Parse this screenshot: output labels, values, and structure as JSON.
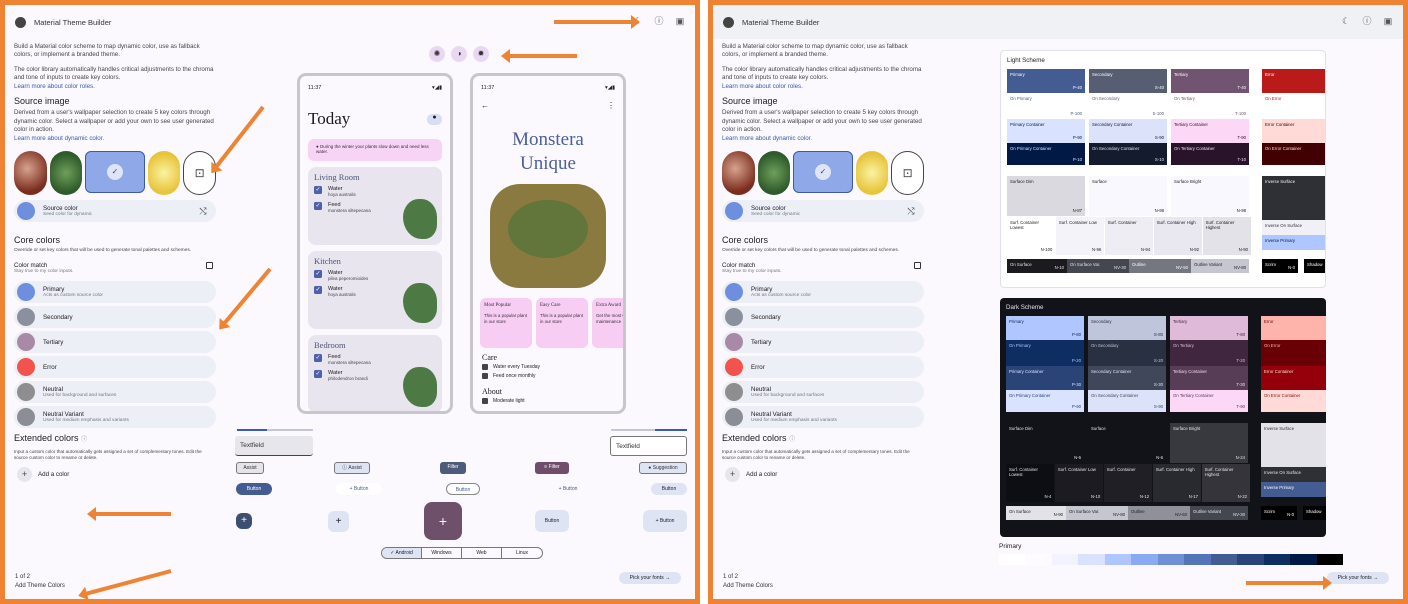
{
  "app_title": "Material Theme Builder",
  "intro": "Build a Material color scheme to map dynamic color, use as fallback colors, or implement a branded theme.",
  "intro2": "The color library automatically handles critical adjustments to the chroma and tone of inputs to create key colors.",
  "learn_colors": "Learn more about color roles.",
  "source_image_title": "Source image",
  "source_image_desc": "Derived from a user's wallpaper selection to create 5 key colors through dynamic color. Select a wallpaper or add your own to see user generated color in action.",
  "learn_dynamic": "Learn more about dynamic color.",
  "source_color": {
    "title": "Source color",
    "sub": "Seed color for dynamic"
  },
  "core_title": "Core colors",
  "core_desc": "Override or set key colors that will be used to generate tonal palettes and schemes.",
  "color_match": {
    "title": "Color match",
    "sub": "Stay true to my color inputs."
  },
  "core_colors": [
    {
      "name": "Primary",
      "sub": "Acts as custom source color",
      "color": "#6e8fde"
    },
    {
      "name": "Secondary",
      "sub": "",
      "color": "#8b909e"
    },
    {
      "name": "Tertiary",
      "sub": "",
      "color": "#a98aa6"
    },
    {
      "name": "Error",
      "sub": "",
      "color": "#f2534c"
    },
    {
      "name": "Neutral",
      "sub": "Used for background and surfaces",
      "color": "#8e8e91"
    },
    {
      "name": "Neutral Variant",
      "sub": "Used for medium emphasis and variants",
      "color": "#8c8e96"
    }
  ],
  "extended_title": "Extended colors",
  "extended_desc": "Input a custom color that automatically gets assigned a set of complementary tones. Edit the source custom color to rename or delete.",
  "add_color": "Add a color",
  "pager": "1 of 2",
  "add_theme": "Add Theme Colors",
  "pick_fonts": "Pick your fonts",
  "phone1": {
    "time": "11:37",
    "title": "Today",
    "banner": "During the winter your plants slow down and need less water.",
    "rooms": [
      {
        "name": "Living Room",
        "items": [
          {
            "t": "Water",
            "s": "hoya australis"
          },
          {
            "t": "Feed",
            "s": "monstera siltepecana"
          }
        ]
      },
      {
        "name": "Kitchen",
        "items": [
          {
            "t": "Water",
            "s": "pilea peperomioides"
          },
          {
            "t": "Water",
            "s": "hoya australis"
          }
        ]
      },
      {
        "name": "Bedroom",
        "items": [
          {
            "t": "Feed",
            "s": "monstera siltepecana"
          },
          {
            "t": "Water",
            "s": "philodendron brandi"
          }
        ]
      }
    ]
  },
  "phone2": {
    "time": "11:37",
    "title_line1": "Monstera",
    "title_line2": "Unique",
    "cards": [
      {
        "title": "Most Popular",
        "body": "This is a popular plant in our store"
      },
      {
        "title": "Easy Care",
        "body": "This is a popular plant in our store"
      },
      {
        "title": "Extra Award",
        "body": "Get the most without maintenance"
      }
    ],
    "care": "Care",
    "care_items": [
      "Water every Tuesday",
      "Feed once monthly"
    ],
    "about": "About",
    "about_items": [
      "Moderate light"
    ]
  },
  "components": {
    "textfield1": "Textfield",
    "textfield2": "Textfield",
    "chips": [
      "Assist",
      "Assist",
      "Filter",
      "Filter",
      "Suggestion"
    ],
    "buttons": [
      "Button",
      "Button",
      "Button",
      "Button",
      "Button"
    ],
    "fab_buttons": [
      "Button",
      "Button"
    ],
    "platforms": [
      "Android",
      "Windows",
      "Web",
      "Linux"
    ]
  },
  "light_scheme": {
    "title": "Light Scheme",
    "tiles": [
      {
        "label": "Primary",
        "tone": "P-40",
        "bg": "#435c92",
        "fg": "#ffffff"
      },
      {
        "label": "On Primary",
        "tone": "P-100",
        "bg": "#ffffff",
        "fg": "#435c92"
      },
      {
        "label": "Primary Container",
        "tone": "P-90",
        "bg": "#d9e2ff",
        "fg": "#001945"
      },
      {
        "label": "On Primary Container",
        "tone": "P-10",
        "bg": "#001945",
        "fg": "#d9e2ff"
      },
      {
        "label": "Secondary",
        "tone": "S-40",
        "bg": "#575e71",
        "fg": "#ffffff"
      },
      {
        "label": "On Secondary",
        "tone": "S-100",
        "bg": "#ffffff",
        "fg": "#575e71"
      },
      {
        "label": "Secondary Container",
        "tone": "S-90",
        "bg": "#dbe2f9",
        "fg": "#141b2c"
      },
      {
        "label": "On Secondary Container",
        "tone": "S-10",
        "bg": "#141b2c",
        "fg": "#dbe2f9"
      },
      {
        "label": "Tertiary",
        "tone": "T-40",
        "bg": "#71546f",
        "fg": "#ffffff"
      },
      {
        "label": "On Tertiary",
        "tone": "T-100",
        "bg": "#ffffff",
        "fg": "#71546f"
      },
      {
        "label": "Tertiary Container",
        "tone": "T-90",
        "bg": "#fcd7f6",
        "fg": "#29132a"
      },
      {
        "label": "On Tertiary Container",
        "tone": "T-10",
        "bg": "#29132a",
        "fg": "#fcd7f6"
      },
      {
        "label": "Error",
        "tone": "E-40",
        "bg": "#ba1a1a",
        "fg": "#ffffff"
      },
      {
        "label": "On Error",
        "tone": "E-100",
        "bg": "#ffffff",
        "fg": "#ba1a1a"
      },
      {
        "label": "Error Container",
        "tone": "E-90",
        "bg": "#ffdad6",
        "fg": "#410002"
      },
      {
        "label": "On Error Container",
        "tone": "E-10",
        "bg": "#410002",
        "fg": "#ffdad6"
      },
      {
        "label": "Surface Dim",
        "tone": "N-87",
        "bg": "#dbd9e0",
        "fg": "#1b1b1f"
      },
      {
        "label": "Surface",
        "tone": "N-98",
        "bg": "#faf8ff",
        "fg": "#1b1b1f"
      },
      {
        "label": "Surface Bright",
        "tone": "N-98",
        "bg": "#faf8ff",
        "fg": "#1b1b1f"
      },
      {
        "label": "Inverse Surface",
        "tone": "N-20",
        "bg": "#2f3036",
        "fg": "#f2f0f7"
      },
      {
        "label": "Inverse On Surface",
        "tone": "N-95",
        "bg": "#f2f0f7",
        "fg": "#2f3036"
      },
      {
        "label": "Inverse Primary",
        "tone": "P-80",
        "bg": "#b0c6ff",
        "fg": "#001945"
      },
      {
        "label": "Surf. Container Lowest",
        "tone": "N-100",
        "bg": "#ffffff",
        "fg": "#1b1b1f"
      },
      {
        "label": "Surf. Container Low",
        "tone": "N-96",
        "bg": "#f4f3fa",
        "fg": "#1b1b1f"
      },
      {
        "label": "Surf. Container",
        "tone": "N-94",
        "bg": "#efedf4",
        "fg": "#1b1b1f"
      },
      {
        "label": "Surf. Container High",
        "tone": "N-92",
        "bg": "#e9e7ef",
        "fg": "#1b1b1f"
      },
      {
        "label": "Surf. Container Highest",
        "tone": "N-90",
        "bg": "#e3e2e9",
        "fg": "#1b1b1f"
      },
      {
        "label": "On Surface",
        "tone": "N-10",
        "bg": "#1b1b1f",
        "fg": "#e3e2e9"
      },
      {
        "label": "On Surface Var.",
        "tone": "NV-30",
        "bg": "#44474f",
        "fg": "#e1e2ec"
      },
      {
        "label": "Outline",
        "tone": "NV-50",
        "bg": "#757780",
        "fg": "#ffffff"
      },
      {
        "label": "Outline Variant",
        "tone": "NV-80",
        "bg": "#c5c6d0",
        "fg": "#1b1b1f"
      },
      {
        "label": "Scrim",
        "tone": "N-0",
        "bg": "#000000",
        "fg": "#ffffff"
      },
      {
        "label": "Shadow",
        "tone": "N-0",
        "bg": "#000000",
        "fg": "#ffffff"
      }
    ]
  },
  "dark_scheme": {
    "title": "Dark Scheme",
    "tiles": [
      {
        "label": "Primary",
        "tone": "P-80",
        "bg": "#b0c6ff",
        "fg": "#0e2d60"
      },
      {
        "label": "On Primary",
        "tone": "P-20",
        "bg": "#0e2d60",
        "fg": "#b0c6ff"
      },
      {
        "label": "Primary Container",
        "tone": "P-30",
        "bg": "#2a4478",
        "fg": "#d9e2ff"
      },
      {
        "label": "On Primary Container",
        "tone": "P-90",
        "bg": "#d9e2ff",
        "fg": "#2a4478"
      },
      {
        "label": "Secondary",
        "tone": "S-80",
        "bg": "#bfc6dc",
        "fg": "#293041"
      },
      {
        "label": "On Secondary",
        "tone": "S-20",
        "bg": "#293041",
        "fg": "#bfc6dc"
      },
      {
        "label": "Secondary Container",
        "tone": "S-30",
        "bg": "#3f4759",
        "fg": "#dbe2f9"
      },
      {
        "label": "On Secondary Container",
        "tone": "S-90",
        "bg": "#dbe2f9",
        "fg": "#3f4759"
      },
      {
        "label": "Tertiary",
        "tone": "T-80",
        "bg": "#dfbbd9",
        "fg": "#40273f"
      },
      {
        "label": "On Tertiary",
        "tone": "T-20",
        "bg": "#40273f",
        "fg": "#dfbbd9"
      },
      {
        "label": "Tertiary Container",
        "tone": "T-30",
        "bg": "#583d57",
        "fg": "#fcd7f6"
      },
      {
        "label": "On Tertiary Container",
        "tone": "T-90",
        "bg": "#fcd7f6",
        "fg": "#583d57"
      },
      {
        "label": "Error",
        "tone": "E-80",
        "bg": "#ffb4ab",
        "fg": "#690005"
      },
      {
        "label": "On Error",
        "tone": "E-20",
        "bg": "#690005",
        "fg": "#ffb4ab"
      },
      {
        "label": "Error Container",
        "tone": "E-30",
        "bg": "#93000a",
        "fg": "#ffdad6"
      },
      {
        "label": "On Error Container",
        "tone": "E-90",
        "bg": "#ffdad6",
        "fg": "#93000a"
      },
      {
        "label": "Surface Dim",
        "tone": "N-6",
        "bg": "#121318",
        "fg": "#e3e2e9"
      },
      {
        "label": "Surface",
        "tone": "N-6",
        "bg": "#121318",
        "fg": "#e3e2e9"
      },
      {
        "label": "Surface Bright",
        "tone": "N-24",
        "bg": "#38393f",
        "fg": "#e3e2e9"
      },
      {
        "label": "Inverse Surface",
        "tone": "N-90",
        "bg": "#e3e2e9",
        "fg": "#2f3036"
      },
      {
        "label": "Inverse On Surface",
        "tone": "N-20",
        "bg": "#2f3036",
        "fg": "#e3e2e9"
      },
      {
        "label": "Inverse Primary",
        "tone": "P-40",
        "bg": "#435c92",
        "fg": "#ffffff"
      },
      {
        "label": "Surf. Container Lowest",
        "tone": "N-4",
        "bg": "#0d0e13",
        "fg": "#e3e2e9"
      },
      {
        "label": "Surf. Container Low",
        "tone": "N-10",
        "bg": "#1b1b21",
        "fg": "#e3e2e9"
      },
      {
        "label": "Surf. Container",
        "tone": "N-12",
        "bg": "#1f1f25",
        "fg": "#e3e2e9"
      },
      {
        "label": "Surf. Container High",
        "tone": "N-17",
        "bg": "#292a2f",
        "fg": "#e3e2e9"
      },
      {
        "label": "Surf. Container Highest",
        "tone": "N-22",
        "bg": "#34343a",
        "fg": "#e3e2e9"
      },
      {
        "label": "On Surface",
        "tone": "N-90",
        "bg": "#e3e2e9",
        "fg": "#1b1b1f"
      },
      {
        "label": "On Surface Var.",
        "tone": "NV-80",
        "bg": "#c5c6d0",
        "fg": "#1b1b1f"
      },
      {
        "label": "Outline",
        "tone": "NV-60",
        "bg": "#8f9099",
        "fg": "#1b1b1f"
      },
      {
        "label": "Outline Variant",
        "tone": "NV-30",
        "bg": "#44474f",
        "fg": "#e3e2e9"
      },
      {
        "label": "Scrim",
        "tone": "N-0",
        "bg": "#000000",
        "fg": "#ffffff"
      },
      {
        "label": "Shadow",
        "tone": "N-0",
        "bg": "#000000",
        "fg": "#ffffff"
      }
    ]
  },
  "palette_title": "Primary",
  "palette_colors": [
    "#ffffff",
    "#fdfbff",
    "#f2f3ff",
    "#d9e2ff",
    "#b0c6ff",
    "#8aaaf4",
    "#6f8fd7",
    "#5575bb",
    "#435c92",
    "#2a4478",
    "#0e2d60",
    "#001945",
    "#000000"
  ]
}
